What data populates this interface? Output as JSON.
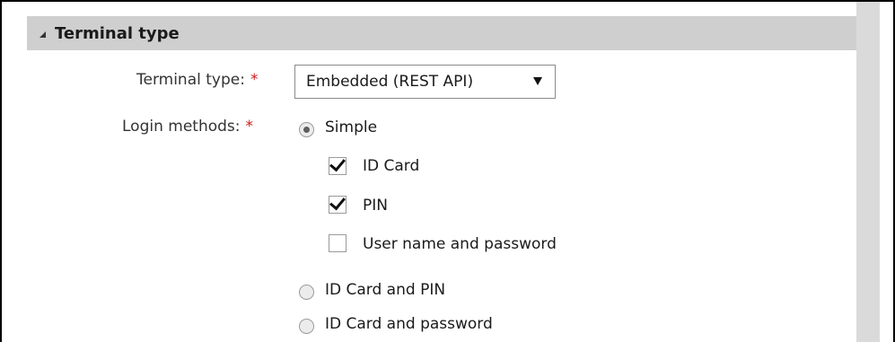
{
  "section": {
    "title": "Terminal type"
  },
  "terminal_type": {
    "label": "Terminal type:",
    "required_mark": "*",
    "selected_value": "Embedded (REST API)"
  },
  "login_methods": {
    "label": "Login methods:",
    "required_mark": "*",
    "options": [
      {
        "label": "Simple",
        "selected": true
      },
      {
        "label": "ID Card and PIN",
        "selected": false
      },
      {
        "label": "ID Card and password",
        "selected": false
      }
    ],
    "simple_suboptions": [
      {
        "label": "ID Card",
        "checked": true
      },
      {
        "label": "PIN",
        "checked": true
      },
      {
        "label": "User name and password",
        "checked": false
      }
    ]
  },
  "colors": {
    "header_bg": "#cfcfcf",
    "required": "#d11a1a",
    "scrollbar": "#dadada"
  }
}
